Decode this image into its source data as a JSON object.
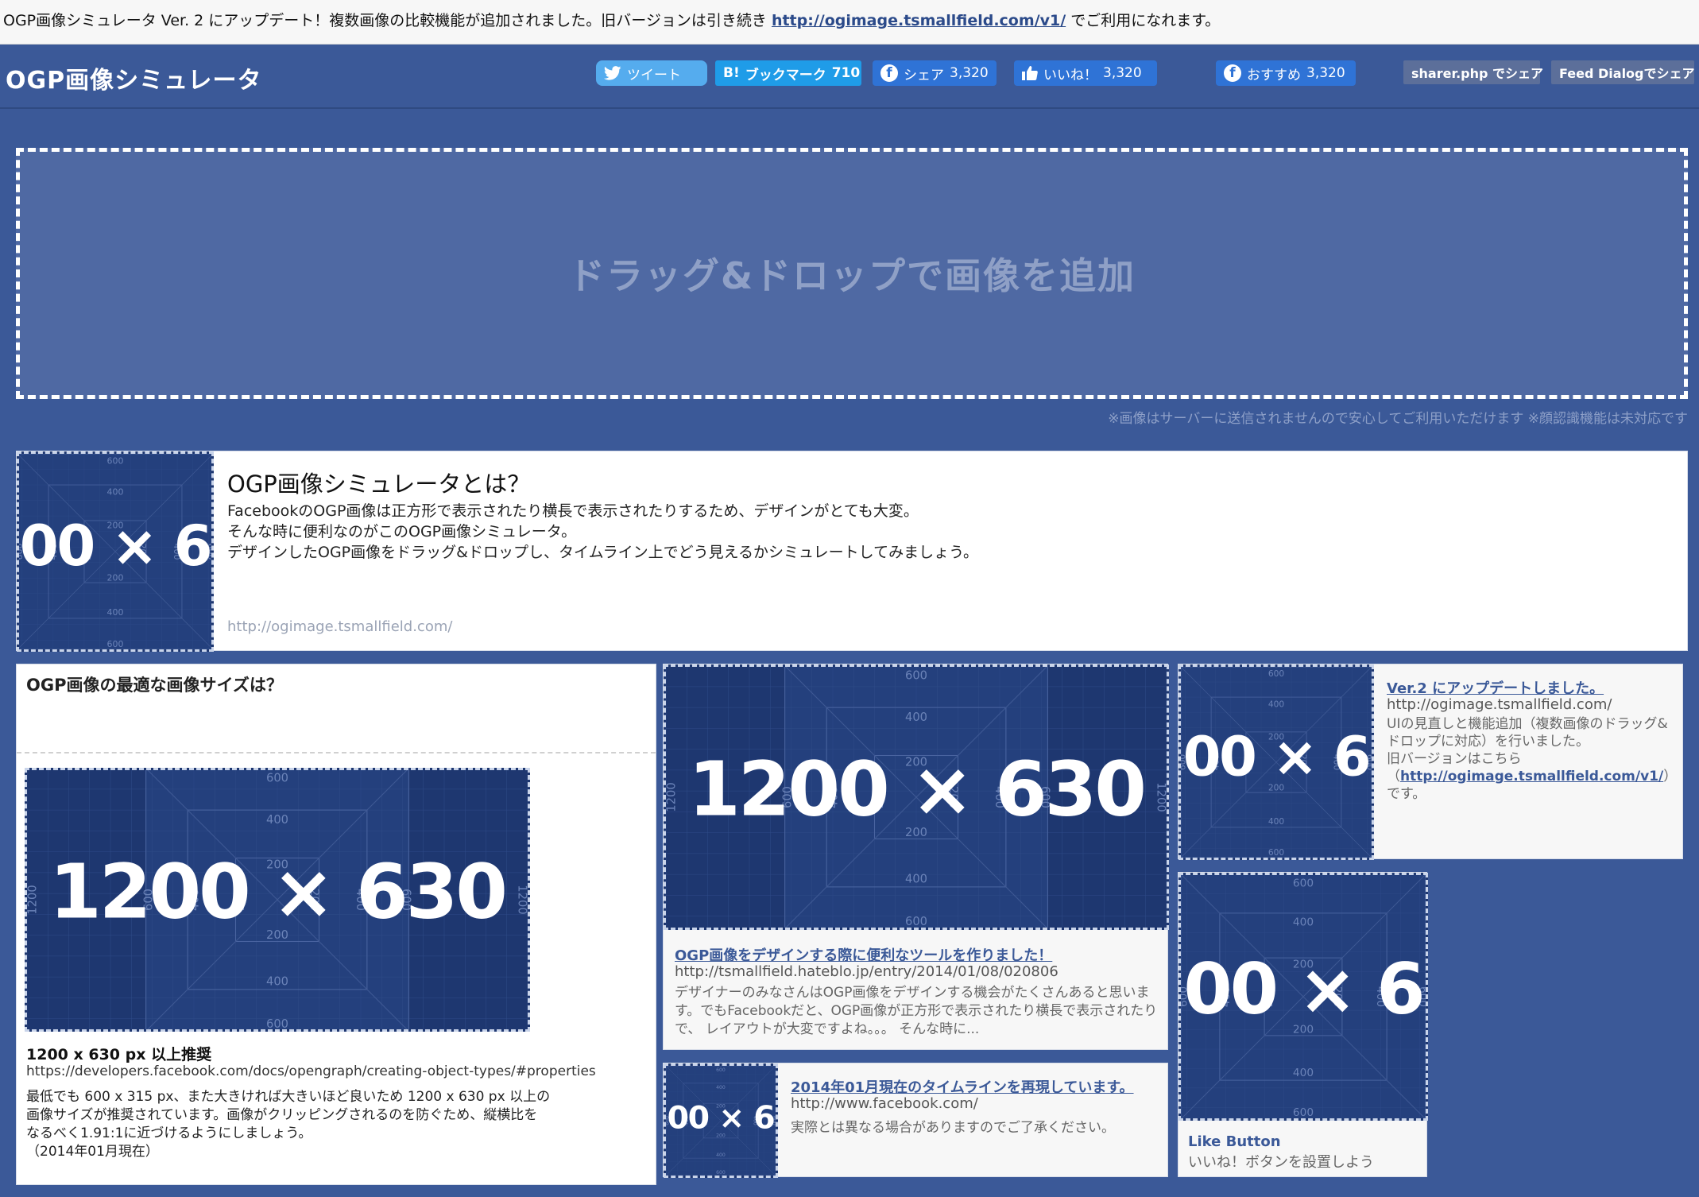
{
  "notice": {
    "text": "OGP画像シミュレータ Ver. 2 にアップデート！複数画像の比較機能が追加されました。旧バージョンは引き続き ",
    "link": "http://ogimage.tsmallfield.com/v1/",
    "suffix": " でご利用になれます。"
  },
  "header": {
    "logo": "OGP画像シミュレータ",
    "tweet": "ツイート",
    "hatena": "ブックマーク",
    "hatena_count": "710",
    "share_label": "シェア",
    "share_count": "3,320",
    "like_label": "いいね！",
    "like_count": "3,320",
    "recommend_label": "おすすめ",
    "recommend_count": "3,320",
    "sharer": "sharer.php でシェア",
    "feed": "Feed Dialogでシェア"
  },
  "dropzone": {
    "label": "ドラッグ&ドロップで画像を追加",
    "note": "※画像はサーバーに送信されませんので安心してご利用いただけます ※顔認識機能は未対応です"
  },
  "intro": {
    "title": "OGP画像シミュレータとは？",
    "line1": "FacebookのOGP画像は正方形で表示されたり横長で表示されたりするため、デザインがとても大変。",
    "line2": "そんな時に便利なのがこのOGP画像シミュレータ。",
    "line3": "デザインしたOGP画像をドラッグ&ドロップし、タイムライン上でどう見えるかシミュレートしてみましょう。",
    "url": "http://ogimage.tsmallfield.com/"
  },
  "size_card": {
    "title": "OGP画像の最適な画像サイズは？",
    "heading": "1200 x 630 px 以上推奨",
    "url": "https://developers.facebook.com/docs/opengraph/creating-object-types/#properties",
    "desc": "最低でも 600 x 315 px、また大きければ大きいほど良いため 1200 x 630 px 以上の画像サイズが推奨されています。画像がクリッピングされるのを防ぐため、縦横比をなるべく1.91:1に近づけるようにしましょう。",
    "date": "（2014年01月現在）"
  },
  "posts": [
    {
      "title": "OGP画像をデザインする際に便利なツールを作りました！",
      "url": "http://tsmallfield.hateblo.jp/entry/2014/01/08/020806",
      "desc": "デザイナーのみなさんはOGP画像をデザインする機会がたくさんあると思います。でもFacebookだと、OGP画像が正方形で表示されたり横長で表示されたりで、 レイアウトが大変ですよね。。。 そんな時に..."
    },
    {
      "title": "2014年01月現在のタイムラインを再現しています。",
      "url": "http://www.facebook.com/",
      "desc": "実際とは異なる場合がありますのでご了承ください。"
    },
    {
      "title": "Ver.2 にアップデートしました。",
      "url": "http://ogimage.tsmallfield.com/",
      "desc": "UIの見直しと機能追加（複数画像のドラッグ&ドロップに対応）を行いました。",
      "desc2": "旧バージョンはこちら",
      "link": "http://ogimage.tsmallfield.com/v1/",
      "desc3": "です。"
    },
    {
      "title": "Like Button",
      "desc": "いいね！ボタンを設置しよう"
    }
  ],
  "ogimage": {
    "label": "1200 × 630",
    "w": "1200",
    "h": "630",
    "times": "×",
    "t600": "600",
    "t400": "400",
    "t200": "200",
    "t1200": "1200"
  },
  "colors": {
    "brand": "#3b5998",
    "ogimage_bg": "#1e3770",
    "twitter": "#55acee",
    "hatena": "#1f9ce8",
    "facebook": "#2f73d6"
  }
}
